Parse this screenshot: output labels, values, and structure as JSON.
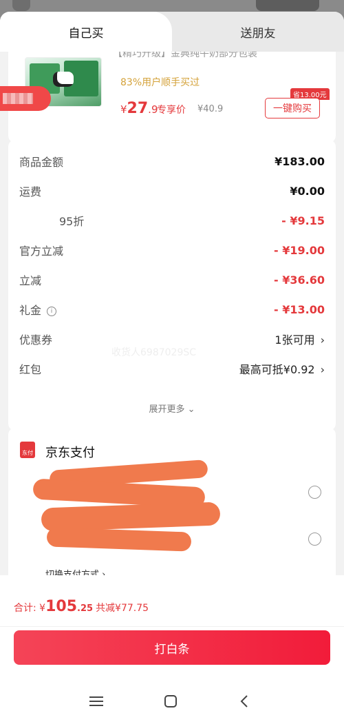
{
  "tabs": {
    "self": "自己买",
    "friend": "送朋友"
  },
  "product": {
    "title": "【精巧升级】金典纯牛奶部分包装",
    "subtitle": "83%用户顺手买过",
    "price_symbol": "¥",
    "price_int": "27",
    "price_dec": ".9",
    "price_tag": "专享价",
    "original_price": "¥40.9",
    "save_badge": "省13.00元",
    "buy_label": "一键购买"
  },
  "summary": {
    "rows": [
      {
        "label": "商品金额",
        "value": "¥183.00"
      },
      {
        "label": "运费",
        "value": "¥0.00"
      },
      {
        "label": "95折",
        "value": "- ¥9.15"
      },
      {
        "label": "官方立减",
        "value": "- ¥19.00"
      },
      {
        "label": "立减",
        "value": "- ¥36.60"
      },
      {
        "label": "礼金",
        "value": "- ¥13.00"
      },
      {
        "label": "优惠券",
        "value": "1张可用"
      },
      {
        "label": "红包",
        "value": "最高可抵¥0.92"
      }
    ],
    "info_glyph": "i",
    "chevron": "›",
    "watermark": "收货人6987029SC",
    "expand": "展开更多 ⌄"
  },
  "payment": {
    "title": "京东支付",
    "icon_text": "东付",
    "switch": "切换支付方式 ›"
  },
  "footer": {
    "total_label": "合计: ",
    "total_symbol": "¥",
    "total_int": "105",
    "total_dec": ".25",
    "saved": "共减¥77.75",
    "pay_button": "打白条"
  },
  "colors": {
    "accent": "#e4393c",
    "button_start": "#f44457",
    "button_end": "#f21c3a"
  }
}
